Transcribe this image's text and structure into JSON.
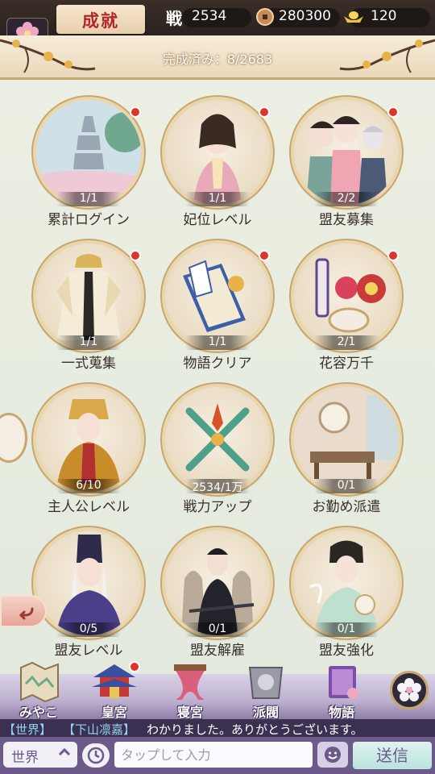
{
  "header": {
    "title": "成就",
    "power_label": "戦",
    "power_value": "2534",
    "coins": "280300",
    "gold": "120"
  },
  "banner": {
    "completed_text": "完成済み：8/2683"
  },
  "achievements": [
    {
      "label": "累計ログイン",
      "progress": "1/1",
      "badge": true
    },
    {
      "label": "妃位レベル",
      "progress": "1/1",
      "badge": true
    },
    {
      "label": "盟友募集",
      "progress": "2/2",
      "badge": true
    },
    {
      "label": "一式蒐集",
      "progress": "1/1",
      "badge": true
    },
    {
      "label": "物語クリア",
      "progress": "1/1",
      "badge": true
    },
    {
      "label": "花容万千",
      "progress": "2/1",
      "badge": true
    },
    {
      "label": "主人公レベル",
      "progress": "6/10",
      "badge": false
    },
    {
      "label": "戦力アップ",
      "progress": "2534/1万",
      "badge": false
    },
    {
      "label": "お勤め派遣",
      "progress": "0/1",
      "badge": false
    },
    {
      "label": "盟友レベル",
      "progress": "0/5",
      "badge": false
    },
    {
      "label": "盟友解雇",
      "progress": "0/1",
      "badge": false
    },
    {
      "label": "盟友強化",
      "progress": "0/1",
      "badge": false
    }
  ],
  "nav": [
    {
      "label": "みやこ",
      "icon": "map-icon"
    },
    {
      "label": "皇宮",
      "icon": "palace-icon"
    },
    {
      "label": "寝宮",
      "icon": "bedroom-icon"
    },
    {
      "label": "派閥",
      "icon": "faction-icon"
    },
    {
      "label": "物語",
      "icon": "book-icon"
    }
  ],
  "chat": {
    "channel_tag": "【世界】",
    "user": "【下山凛嘉】",
    "message": "わかりました。ありがとうございます。",
    "channel_select": "世界",
    "input_placeholder": "タップして入力",
    "send_label": "送信"
  },
  "colors": {
    "accent_gold": "#c9a670",
    "badge_red": "#e0332b",
    "title_red": "#b3262b",
    "chat_purple": "#6b5a8a"
  }
}
